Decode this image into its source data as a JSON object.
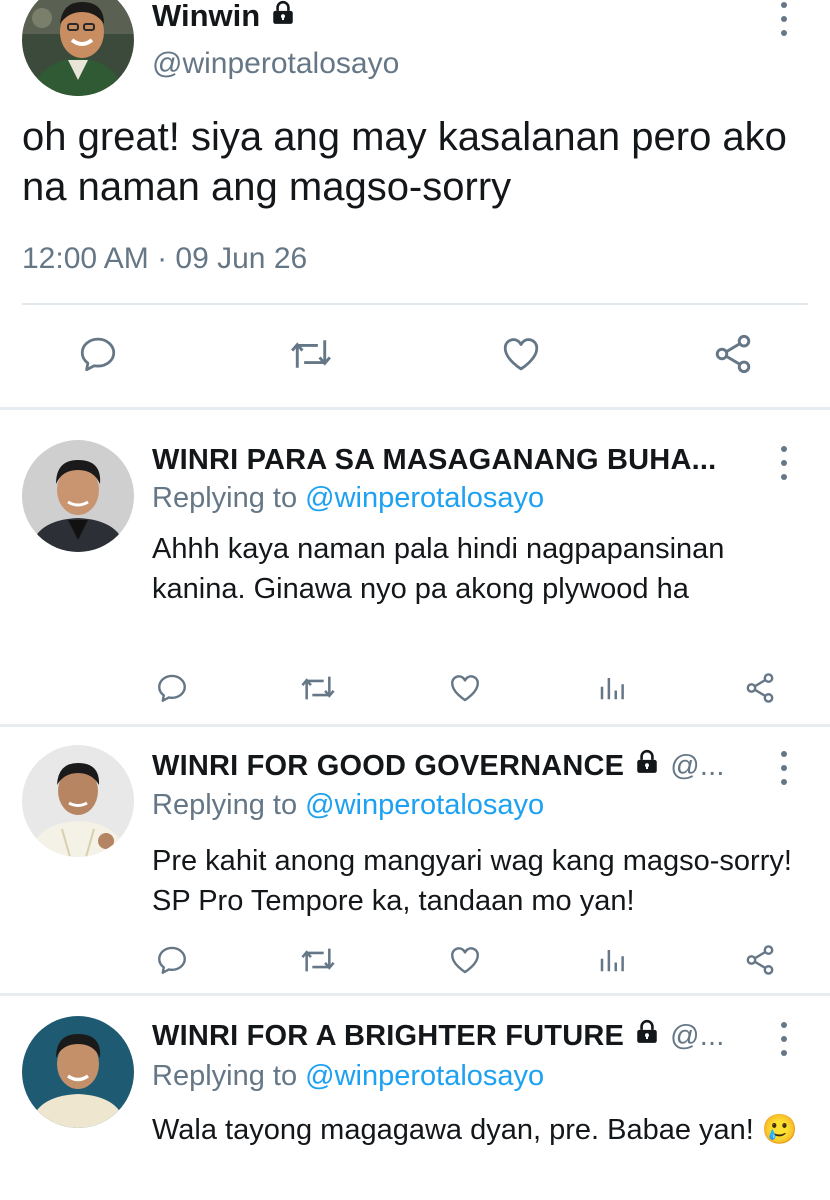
{
  "main_tweet": {
    "name": "Winwin",
    "handle": "@winperotalosayo",
    "text": "oh great! siya ang may kasalanan pero ako na naman ang magso-sorry",
    "timestamp": "12:00 AM · 09 Jun 26",
    "actions": [
      "reply-icon",
      "retweet-icon",
      "like-icon",
      "share-icon"
    ]
  },
  "replies": [
    {
      "name": "WINRI PARA SA MASAGANANG BUHA...",
      "handle_truncated": "",
      "replying_prefix": "Replying to ",
      "replying_to": "@winperotalosayo",
      "text": "Ahhh kaya naman pala hindi nagpapansinan kanina. Ginawa nyo pa akong plywood ha"
    },
    {
      "name": "WINRI FOR GOOD GOVERNANCE",
      "handle_truncated": "@...",
      "replying_prefix": "Replying to ",
      "replying_to": "@winperotalosayo",
      "text": "Pre kahit anong mangyari wag kang magso-sorry! SP Pro Tempore ka, tandaan mo yan!"
    },
    {
      "name": "WINRI FOR A BRIGHTER FUTURE",
      "handle_truncated": "@...",
      "replying_prefix": "Replying to ",
      "replying_to": "@winperotalosayo",
      "text": "Wala tayong magagawa dyan, pre. Babae yan! 🥲"
    }
  ],
  "colors": {
    "text": "#14171a",
    "secondary": "#657786",
    "accent": "#1da1f2",
    "divider": "#e6ecf0",
    "icon": "#657786"
  }
}
